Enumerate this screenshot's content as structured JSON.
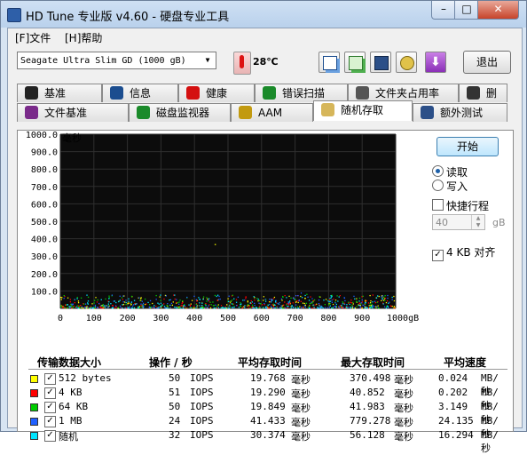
{
  "window": {
    "title": "HD Tune 专业版 v4.60 - 硬盘专业工具",
    "min": "–",
    "max": "□",
    "close": "✕"
  },
  "menu": {
    "file": "[F]文件",
    "help": "[H]帮助"
  },
  "toolbar": {
    "drive": "Seagate Ultra Slim GD  (1000 gB)",
    "temperature": "28℃",
    "exit": "退出"
  },
  "tabs_row1": [
    {
      "label": "基准",
      "icon": "benchmark-icon"
    },
    {
      "label": "信息",
      "icon": "info-icon"
    },
    {
      "label": "健康",
      "icon": "health-icon"
    },
    {
      "label": "错误扫描",
      "icon": "error-scan-icon"
    },
    {
      "label": "文件夹占用率",
      "icon": "folder-usage-icon"
    },
    {
      "label": "删除",
      "icon": "delete-icon"
    }
  ],
  "tabs_row2": [
    {
      "label": "文件基准",
      "icon": "file-benchmark-icon"
    },
    {
      "label": "磁盘监视器",
      "icon": "disk-monitor-icon"
    },
    {
      "label": "AAM",
      "icon": "speaker-icon"
    },
    {
      "label": "随机存取",
      "icon": "random-access-icon"
    },
    {
      "label": "额外测试",
      "icon": "extra-tests-icon"
    }
  ],
  "right_panel": {
    "start": "开始",
    "read": "读取",
    "write": "写入",
    "short_stroke": "快捷行程",
    "short_stroke_value": "40",
    "short_stroke_unit": "gB",
    "align": "4 KB 对齐"
  },
  "chart_data": {
    "type": "scatter",
    "ylabel": "毫秒",
    "ylim": [
      0,
      1000
    ],
    "y_ticks": [
      "1000.0",
      "900.0",
      "800.0",
      "700.0",
      "600.0",
      "500.0",
      "400.0",
      "300.0",
      "200.0",
      "100.0"
    ],
    "xlim": [
      0,
      1000
    ],
    "x_ticks": [
      "0",
      "100",
      "200",
      "300",
      "400",
      "500",
      "600",
      "700",
      "800",
      "900",
      "1000gB"
    ],
    "grid": true,
    "series": [
      {
        "name": "512 bytes",
        "color": "#ffff00"
      },
      {
        "name": "4 KB",
        "color": "#ff0000"
      },
      {
        "name": "64 KB",
        "color": "#00cc00"
      },
      {
        "name": "1 MB",
        "color": "#2060ff"
      },
      {
        "name": "随机",
        "color": "#00e5ff"
      }
    ],
    "band": {
      "min_ms": 5,
      "max_ms": 80,
      "outlier_x": 460,
      "outlier_y": 370
    }
  },
  "table": {
    "headers": [
      "传输数据大小",
      "操作 / 秒",
      "平均存取时间",
      "最大存取时间",
      "平均速度"
    ],
    "rows": [
      {
        "color": "#ffff00",
        "name": "512 bytes",
        "ops": "50",
        "ops_unit": "IOPS",
        "avg": "19.768",
        "avg_unit": "毫秒",
        "max": "370.498",
        "max_unit": "毫秒",
        "speed": "0.024",
        "speed_unit": "MB/秒"
      },
      {
        "color": "#ff0000",
        "name": "4 KB",
        "ops": "51",
        "ops_unit": "IOPS",
        "avg": "19.290",
        "avg_unit": "毫秒",
        "max": "40.852",
        "max_unit": "毫秒",
        "speed": "0.202",
        "speed_unit": "MB/秒"
      },
      {
        "color": "#00cc00",
        "name": "64 KB",
        "ops": "50",
        "ops_unit": "IOPS",
        "avg": "19.849",
        "avg_unit": "毫秒",
        "max": "41.983",
        "max_unit": "毫秒",
        "speed": "3.149",
        "speed_unit": "MB/秒"
      },
      {
        "color": "#2060ff",
        "name": "1 MB",
        "ops": "24",
        "ops_unit": "IOPS",
        "avg": "41.433",
        "avg_unit": "毫秒",
        "max": "779.278",
        "max_unit": "毫秒",
        "speed": "24.135",
        "speed_unit": "MB/秒"
      },
      {
        "color": "#00e5ff",
        "name": "随机",
        "ops": "32",
        "ops_unit": "IOPS",
        "avg": "30.374",
        "avg_unit": "毫秒",
        "max": "56.128",
        "max_unit": "毫秒",
        "speed": "16.294",
        "speed_unit": "MB/秒"
      }
    ]
  }
}
